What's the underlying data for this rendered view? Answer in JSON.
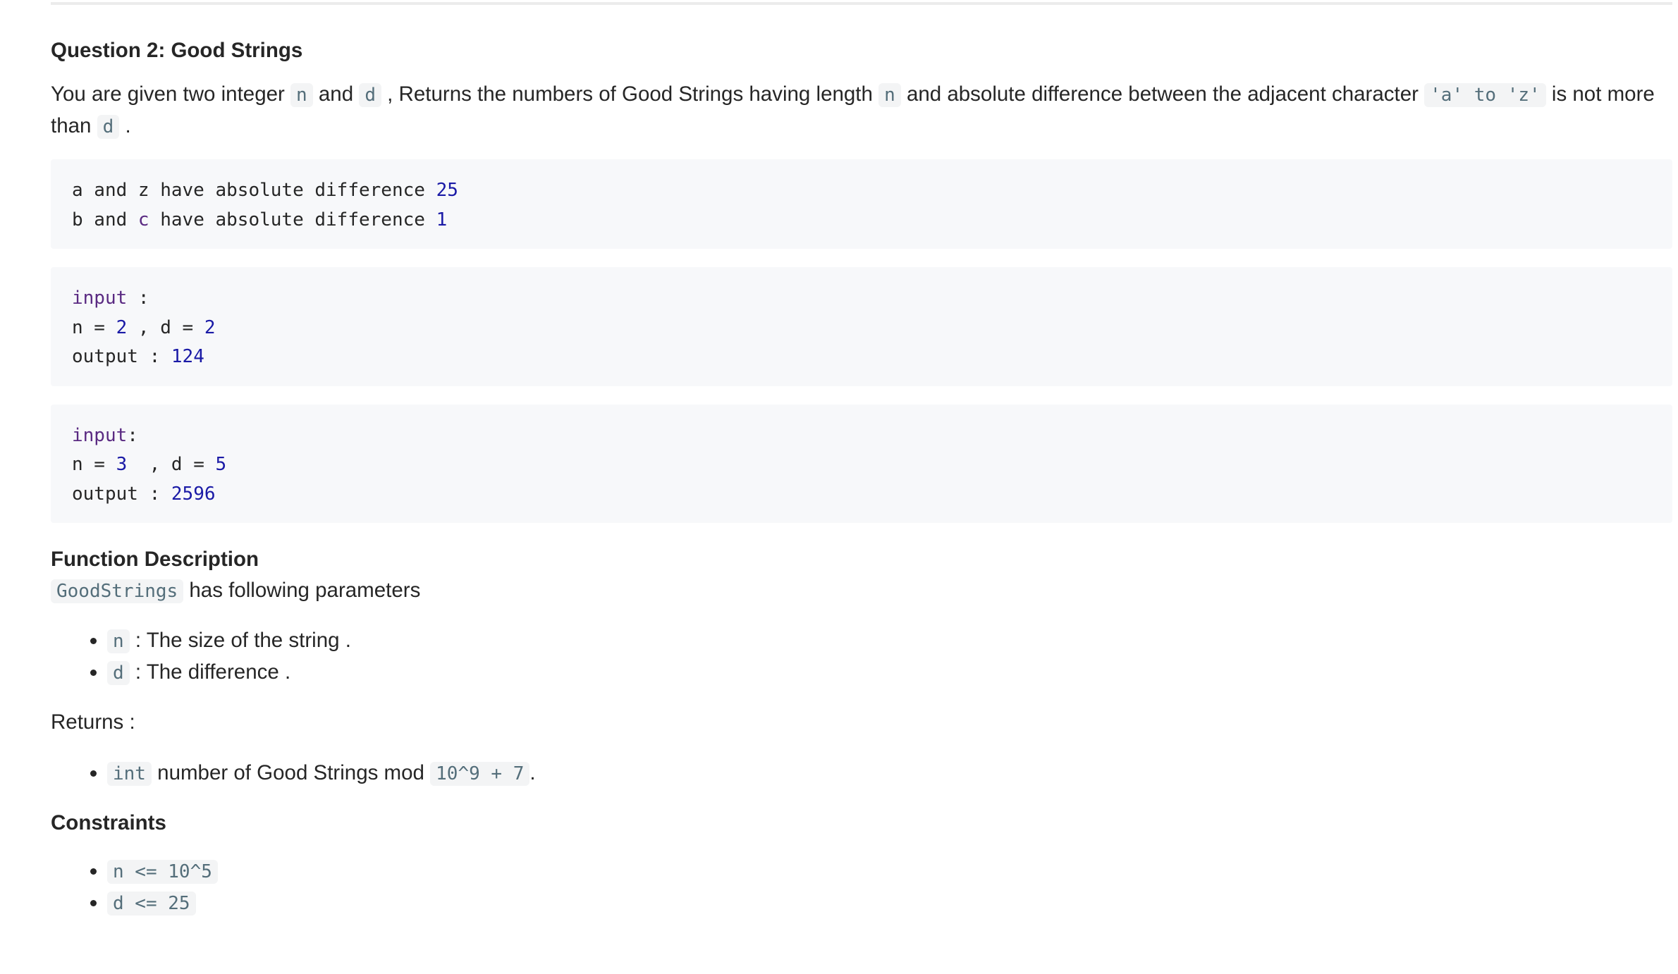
{
  "title": "Question 2: Good Strings",
  "intro": {
    "t1": "You are given two integer ",
    "c1": "n",
    "t2": " and ",
    "c2": "d",
    "t3": " , Returns the numbers of Good Strings having length ",
    "c3": "n",
    "t4": " and absolute difference between the adjacent character ",
    "c4": "'a' to 'z'",
    "t5": " is not more than ",
    "c5": "d",
    "t6": " ."
  },
  "examples": {
    "diff": {
      "l1_text": "a and z have absolute difference ",
      "l1_num": "25",
      "l2_a": "b and ",
      "l2_kw": "c",
      "l2_b": " have absolute difference ",
      "l2_num": "1"
    },
    "ex1": {
      "input_kw": "input",
      "input_rest": " :",
      "n_label": "n = ",
      "n_val": "2",
      "mid": " , d = ",
      "d_val": "2",
      "out_label": "output : ",
      "out_val": "124"
    },
    "ex2": {
      "input_kw": "input",
      "input_rest": ":",
      "n_label": "n = ",
      "n_val": "3",
      "mid": "  , d = ",
      "d_val": "5",
      "out_label": "output : ",
      "out_val": "2596"
    }
  },
  "function_description": {
    "heading": "Function Description",
    "func_name": "GoodStrings",
    "func_text": " has following parameters",
    "params": [
      {
        "code": "n",
        "text": " : The size of the string ."
      },
      {
        "code": "d",
        "text": " : The difference ."
      }
    ]
  },
  "returns": {
    "heading": "Returns :",
    "item_code1": "int",
    "item_text": " number of Good Strings mod ",
    "item_code2": "10^9 + 7",
    "item_tail": "."
  },
  "constraints": {
    "heading": "Constraints",
    "items": [
      "n <= 10^5",
      "d <= 25"
    ]
  }
}
